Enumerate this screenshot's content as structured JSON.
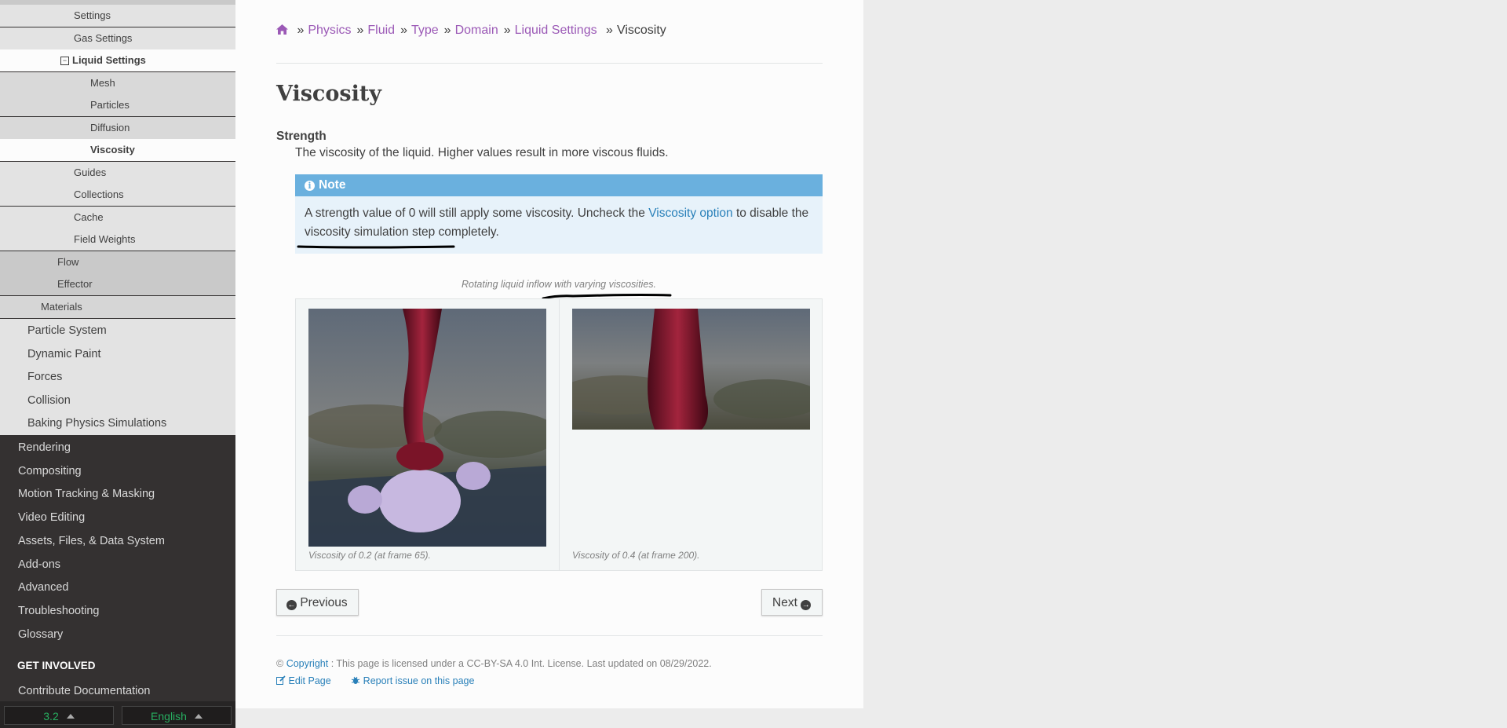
{
  "sidebar": {
    "fluid_children": [
      "Settings",
      "Gas Settings"
    ],
    "liquid_settings_label": "Liquid Settings",
    "liquid_children": [
      "Mesh",
      "Particles",
      "Diffusion"
    ],
    "current_label": "Viscosity",
    "fluid_after": [
      "Guides",
      "Collections",
      "Cache",
      "Field Weights"
    ],
    "level3": [
      "Flow",
      "Effector"
    ],
    "level2": [
      "Materials"
    ],
    "physics_items": [
      "Particle System",
      "Dynamic Paint",
      "Forces",
      "Collision",
      "Baking Physics Simulations"
    ],
    "top_items": [
      "Rendering",
      "Compositing",
      "Motion Tracking & Masking",
      "Video Editing",
      "Assets, Files, & Data System",
      "Add-ons",
      "Advanced",
      "Troubleshooting",
      "Glossary"
    ],
    "caption": "GET INVOLVED",
    "involved_items": [
      "Contribute Documentation"
    ],
    "version": "3.2",
    "language": "English"
  },
  "breadcrumbs": {
    "separator": "»",
    "links": [
      "Physics",
      "Fluid",
      "Type",
      "Domain",
      "Liquid Settings"
    ],
    "current": "Viscosity"
  },
  "page": {
    "title": "Viscosity",
    "term": "Strength",
    "definition": "The viscosity of the liquid. Higher values result in more viscous fluids."
  },
  "note": {
    "title": "Note",
    "text_before": "A strength value of 0 will still apply some viscosity. Uncheck the ",
    "link": "Viscosity option",
    "text_after": " to disable the viscosity simulation step completely."
  },
  "figure": {
    "caption": "Rotating liquid inflow with varying viscosities.",
    "images": [
      {
        "caption": "Viscosity of 0.2 (at frame 65)."
      },
      {
        "caption": "Viscosity of 0.4 (at frame 200)."
      }
    ]
  },
  "nav": {
    "previous": "Previous",
    "next": "Next"
  },
  "footer": {
    "copyright_symbol": "©",
    "copyright_link": "Copyright",
    "license_text": ": This page is licensed under a CC-BY-SA 4.0 Int. License. Last updated on 08/29/2022.",
    "edit_page": "Edit Page",
    "report_issue": "Report issue on this page"
  },
  "colors": {
    "link": "#9b59b6",
    "note_header": "#6ab0de",
    "note_bg": "#e7f2fa",
    "sidebar_dark": "#343131",
    "version_green": "#27ae60"
  }
}
